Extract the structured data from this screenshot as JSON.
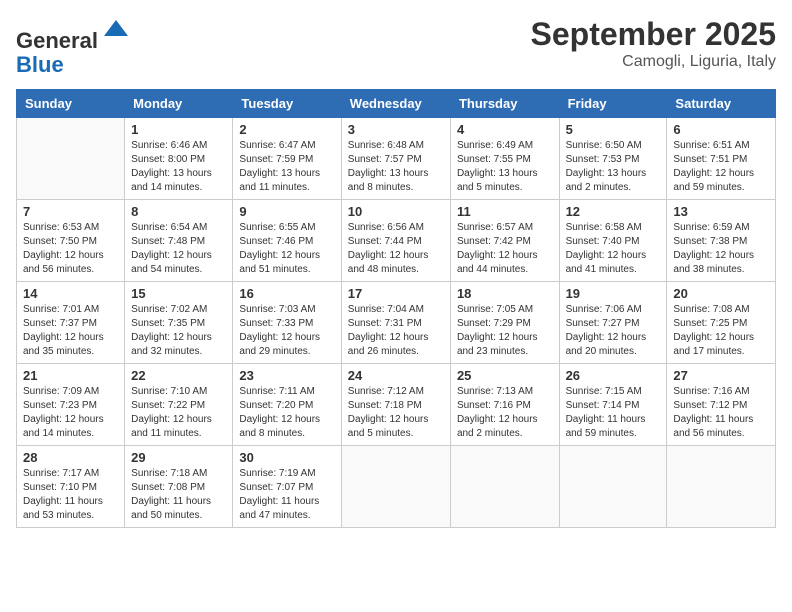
{
  "header": {
    "logo_line1": "General",
    "logo_line2": "Blue",
    "month": "September 2025",
    "location": "Camogli, Liguria, Italy"
  },
  "days_of_week": [
    "Sunday",
    "Monday",
    "Tuesday",
    "Wednesday",
    "Thursday",
    "Friday",
    "Saturday"
  ],
  "weeks": [
    [
      {
        "num": "",
        "info": ""
      },
      {
        "num": "1",
        "info": "Sunrise: 6:46 AM\nSunset: 8:00 PM\nDaylight: 13 hours\nand 14 minutes."
      },
      {
        "num": "2",
        "info": "Sunrise: 6:47 AM\nSunset: 7:59 PM\nDaylight: 13 hours\nand 11 minutes."
      },
      {
        "num": "3",
        "info": "Sunrise: 6:48 AM\nSunset: 7:57 PM\nDaylight: 13 hours\nand 8 minutes."
      },
      {
        "num": "4",
        "info": "Sunrise: 6:49 AM\nSunset: 7:55 PM\nDaylight: 13 hours\nand 5 minutes."
      },
      {
        "num": "5",
        "info": "Sunrise: 6:50 AM\nSunset: 7:53 PM\nDaylight: 13 hours\nand 2 minutes."
      },
      {
        "num": "6",
        "info": "Sunrise: 6:51 AM\nSunset: 7:51 PM\nDaylight: 12 hours\nand 59 minutes."
      }
    ],
    [
      {
        "num": "7",
        "info": "Sunrise: 6:53 AM\nSunset: 7:50 PM\nDaylight: 12 hours\nand 56 minutes."
      },
      {
        "num": "8",
        "info": "Sunrise: 6:54 AM\nSunset: 7:48 PM\nDaylight: 12 hours\nand 54 minutes."
      },
      {
        "num": "9",
        "info": "Sunrise: 6:55 AM\nSunset: 7:46 PM\nDaylight: 12 hours\nand 51 minutes."
      },
      {
        "num": "10",
        "info": "Sunrise: 6:56 AM\nSunset: 7:44 PM\nDaylight: 12 hours\nand 48 minutes."
      },
      {
        "num": "11",
        "info": "Sunrise: 6:57 AM\nSunset: 7:42 PM\nDaylight: 12 hours\nand 44 minutes."
      },
      {
        "num": "12",
        "info": "Sunrise: 6:58 AM\nSunset: 7:40 PM\nDaylight: 12 hours\nand 41 minutes."
      },
      {
        "num": "13",
        "info": "Sunrise: 6:59 AM\nSunset: 7:38 PM\nDaylight: 12 hours\nand 38 minutes."
      }
    ],
    [
      {
        "num": "14",
        "info": "Sunrise: 7:01 AM\nSunset: 7:37 PM\nDaylight: 12 hours\nand 35 minutes."
      },
      {
        "num": "15",
        "info": "Sunrise: 7:02 AM\nSunset: 7:35 PM\nDaylight: 12 hours\nand 32 minutes."
      },
      {
        "num": "16",
        "info": "Sunrise: 7:03 AM\nSunset: 7:33 PM\nDaylight: 12 hours\nand 29 minutes."
      },
      {
        "num": "17",
        "info": "Sunrise: 7:04 AM\nSunset: 7:31 PM\nDaylight: 12 hours\nand 26 minutes."
      },
      {
        "num": "18",
        "info": "Sunrise: 7:05 AM\nSunset: 7:29 PM\nDaylight: 12 hours\nand 23 minutes."
      },
      {
        "num": "19",
        "info": "Sunrise: 7:06 AM\nSunset: 7:27 PM\nDaylight: 12 hours\nand 20 minutes."
      },
      {
        "num": "20",
        "info": "Sunrise: 7:08 AM\nSunset: 7:25 PM\nDaylight: 12 hours\nand 17 minutes."
      }
    ],
    [
      {
        "num": "21",
        "info": "Sunrise: 7:09 AM\nSunset: 7:23 PM\nDaylight: 12 hours\nand 14 minutes."
      },
      {
        "num": "22",
        "info": "Sunrise: 7:10 AM\nSunset: 7:22 PM\nDaylight: 12 hours\nand 11 minutes."
      },
      {
        "num": "23",
        "info": "Sunrise: 7:11 AM\nSunset: 7:20 PM\nDaylight: 12 hours\nand 8 minutes."
      },
      {
        "num": "24",
        "info": "Sunrise: 7:12 AM\nSunset: 7:18 PM\nDaylight: 12 hours\nand 5 minutes."
      },
      {
        "num": "25",
        "info": "Sunrise: 7:13 AM\nSunset: 7:16 PM\nDaylight: 12 hours\nand 2 minutes."
      },
      {
        "num": "26",
        "info": "Sunrise: 7:15 AM\nSunset: 7:14 PM\nDaylight: 11 hours\nand 59 minutes."
      },
      {
        "num": "27",
        "info": "Sunrise: 7:16 AM\nSunset: 7:12 PM\nDaylight: 11 hours\nand 56 minutes."
      }
    ],
    [
      {
        "num": "28",
        "info": "Sunrise: 7:17 AM\nSunset: 7:10 PM\nDaylight: 11 hours\nand 53 minutes."
      },
      {
        "num": "29",
        "info": "Sunrise: 7:18 AM\nSunset: 7:08 PM\nDaylight: 11 hours\nand 50 minutes."
      },
      {
        "num": "30",
        "info": "Sunrise: 7:19 AM\nSunset: 7:07 PM\nDaylight: 11 hours\nand 47 minutes."
      },
      {
        "num": "",
        "info": ""
      },
      {
        "num": "",
        "info": ""
      },
      {
        "num": "",
        "info": ""
      },
      {
        "num": "",
        "info": ""
      }
    ]
  ]
}
